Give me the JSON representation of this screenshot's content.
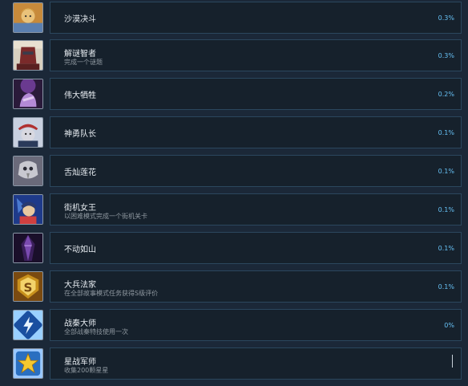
{
  "achievements": [
    {
      "title": "沙漠决斗",
      "desc": "",
      "percent": "0.3%",
      "icon": "warrior-portrait-icon",
      "colors": [
        "#c78a3b",
        "#e9c27a",
        "#5a7fb0"
      ]
    },
    {
      "title": "解谜智者",
      "desc": "完成一个谜题",
      "percent": "0.3%",
      "icon": "masked-warrior-icon",
      "colors": [
        "#7a2a2a",
        "#c9b7a0",
        "#3b3b4a"
      ]
    },
    {
      "title": "伟大牺牲",
      "desc": "",
      "percent": "0.2%",
      "icon": "purple-hand-icon",
      "colors": [
        "#4a2a6b",
        "#b48ad6",
        "#2a1a3a"
      ]
    },
    {
      "title": "神勇队长",
      "desc": "",
      "percent": "0.1%",
      "icon": "red-hat-captain-icon",
      "colors": [
        "#2a3a5a",
        "#d8d8e0",
        "#b03030"
      ]
    },
    {
      "title": "舌灿莲花",
      "desc": "",
      "percent": "0.1%",
      "icon": "skull-bird-icon",
      "colors": [
        "#2a2a35",
        "#c8c8d0",
        "#6a6a7a"
      ]
    },
    {
      "title": "街机女王",
      "desc": "以困难模式完成一个街机关卡",
      "percent": "0.1%",
      "icon": "blue-queen-icon",
      "colors": [
        "#1e3a8a",
        "#d04040",
        "#e8c8a0"
      ]
    },
    {
      "title": "不动如山",
      "desc": "",
      "percent": "0.1%",
      "icon": "purple-crystal-icon",
      "colors": [
        "#3a1f5a",
        "#7a4ab0",
        "#1a0f2a"
      ]
    },
    {
      "title": "大兵法家",
      "desc": "在全部故事模式任务获得S级评价",
      "percent": "0.1%",
      "icon": "gold-s-badge-icon",
      "colors": [
        "#c8901c",
        "#f3d36b",
        "#7a4a10"
      ]
    },
    {
      "title": "战秦大师",
      "desc": "全部战秦特技使用一次",
      "percent": "0%",
      "icon": "lightning-shield-icon",
      "colors": [
        "#1a4fa0",
        "#9ad0ff",
        "#e8f4ff"
      ]
    },
    {
      "title": "星战军师",
      "desc": "收集200颗星星",
      "percent": "",
      "icon": "gold-star-icon",
      "colors": [
        "#2a6fc0",
        "#f5c830",
        "#9ac8ff"
      ]
    }
  ]
}
